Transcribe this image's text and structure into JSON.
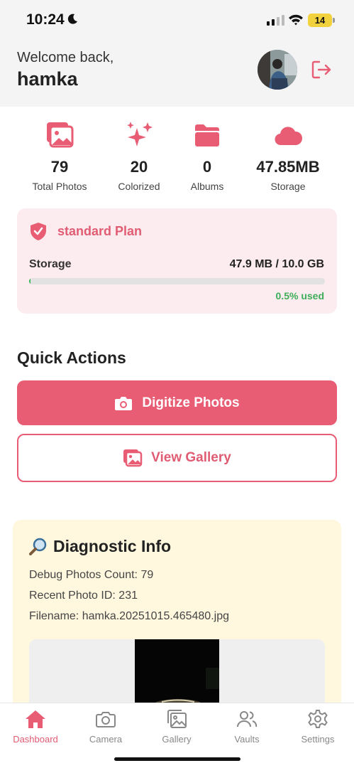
{
  "status_bar": {
    "time": "10:24",
    "battery": "14",
    "icons": [
      "moon-icon",
      "signal-icon",
      "wifi-icon",
      "battery-icon"
    ]
  },
  "header": {
    "welcome": "Welcome back,",
    "username": "hamka"
  },
  "stats": [
    {
      "value": "79",
      "label": "Total Photos",
      "icon": "photos-icon"
    },
    {
      "value": "20",
      "label": "Colorized",
      "icon": "sparkles-icon"
    },
    {
      "value": "0",
      "label": "Albums",
      "icon": "folder-icon"
    },
    {
      "value": "47.85MB",
      "label": "Storage",
      "icon": "cloud-icon"
    }
  ],
  "plan": {
    "title": "standard Plan",
    "storage_label": "Storage",
    "storage_value": "47.9 MB / 10.0 GB",
    "used_text": "0.5% used",
    "used_fraction": 0.005
  },
  "quick_actions": {
    "title": "Quick Actions",
    "digitize_label": "Digitize Photos",
    "gallery_label": "View Gallery"
  },
  "diagnostic": {
    "title": "Diagnostic Info",
    "debug_count": "Debug Photos Count: 79",
    "recent_id": "Recent Photo ID: 231",
    "filename": "Filename: hamka.20251015.465480.jpg"
  },
  "tabs": [
    {
      "label": "Dashboard",
      "icon": "home-icon",
      "active": true
    },
    {
      "label": "Camera",
      "icon": "camera-icon",
      "active": false
    },
    {
      "label": "Gallery",
      "icon": "gallery-icon",
      "active": false
    },
    {
      "label": "Vaults",
      "icon": "users-icon",
      "active": false
    },
    {
      "label": "Settings",
      "icon": "gear-icon",
      "active": false
    }
  ],
  "colors": {
    "accent": "#e85c74",
    "success": "#3cae58",
    "plan_bg": "#fdecef",
    "diag_bg": "#fff8df"
  }
}
